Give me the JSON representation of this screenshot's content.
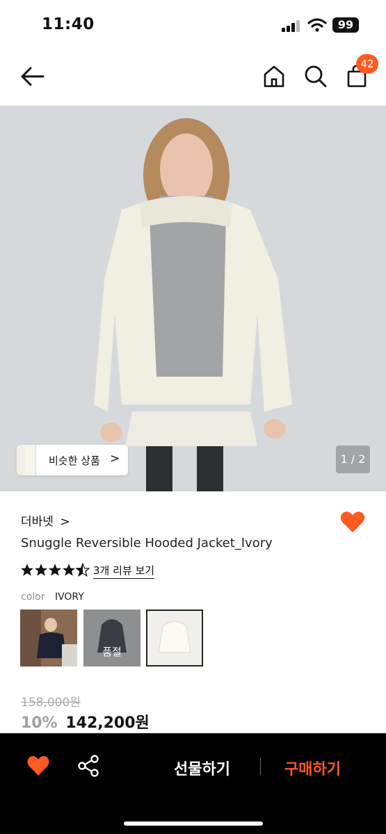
{
  "status": {
    "time": "11:40",
    "battery": "99"
  },
  "nav": {
    "cart_count": "42"
  },
  "image": {
    "page_indicator": "1 / 2",
    "similar_label": "비슷한 상품",
    "similar_chevron": ">"
  },
  "product": {
    "brand": "더바넷",
    "brand_chevron": ">",
    "name": "Snuggle Reversible Hooded Jacket_Ivory",
    "rating": 4.5,
    "review_link": "3개 리뷰 보기",
    "color_label": "color",
    "color_value": "IVORY",
    "swatches": [
      {
        "name": "navy-styled",
        "soldout": ""
      },
      {
        "name": "charcoal",
        "soldout": "품절"
      },
      {
        "name": "ivory",
        "soldout": ""
      }
    ],
    "original_price": "158,000원",
    "discount_rate": "10%",
    "sale_price": "142,200원"
  },
  "bottom": {
    "gift_label": "선물하기",
    "buy_label": "구매하기"
  },
  "colors": {
    "accent": "#ff5a1f",
    "bar": "#000000",
    "image_bg": "#d6d9dc"
  }
}
